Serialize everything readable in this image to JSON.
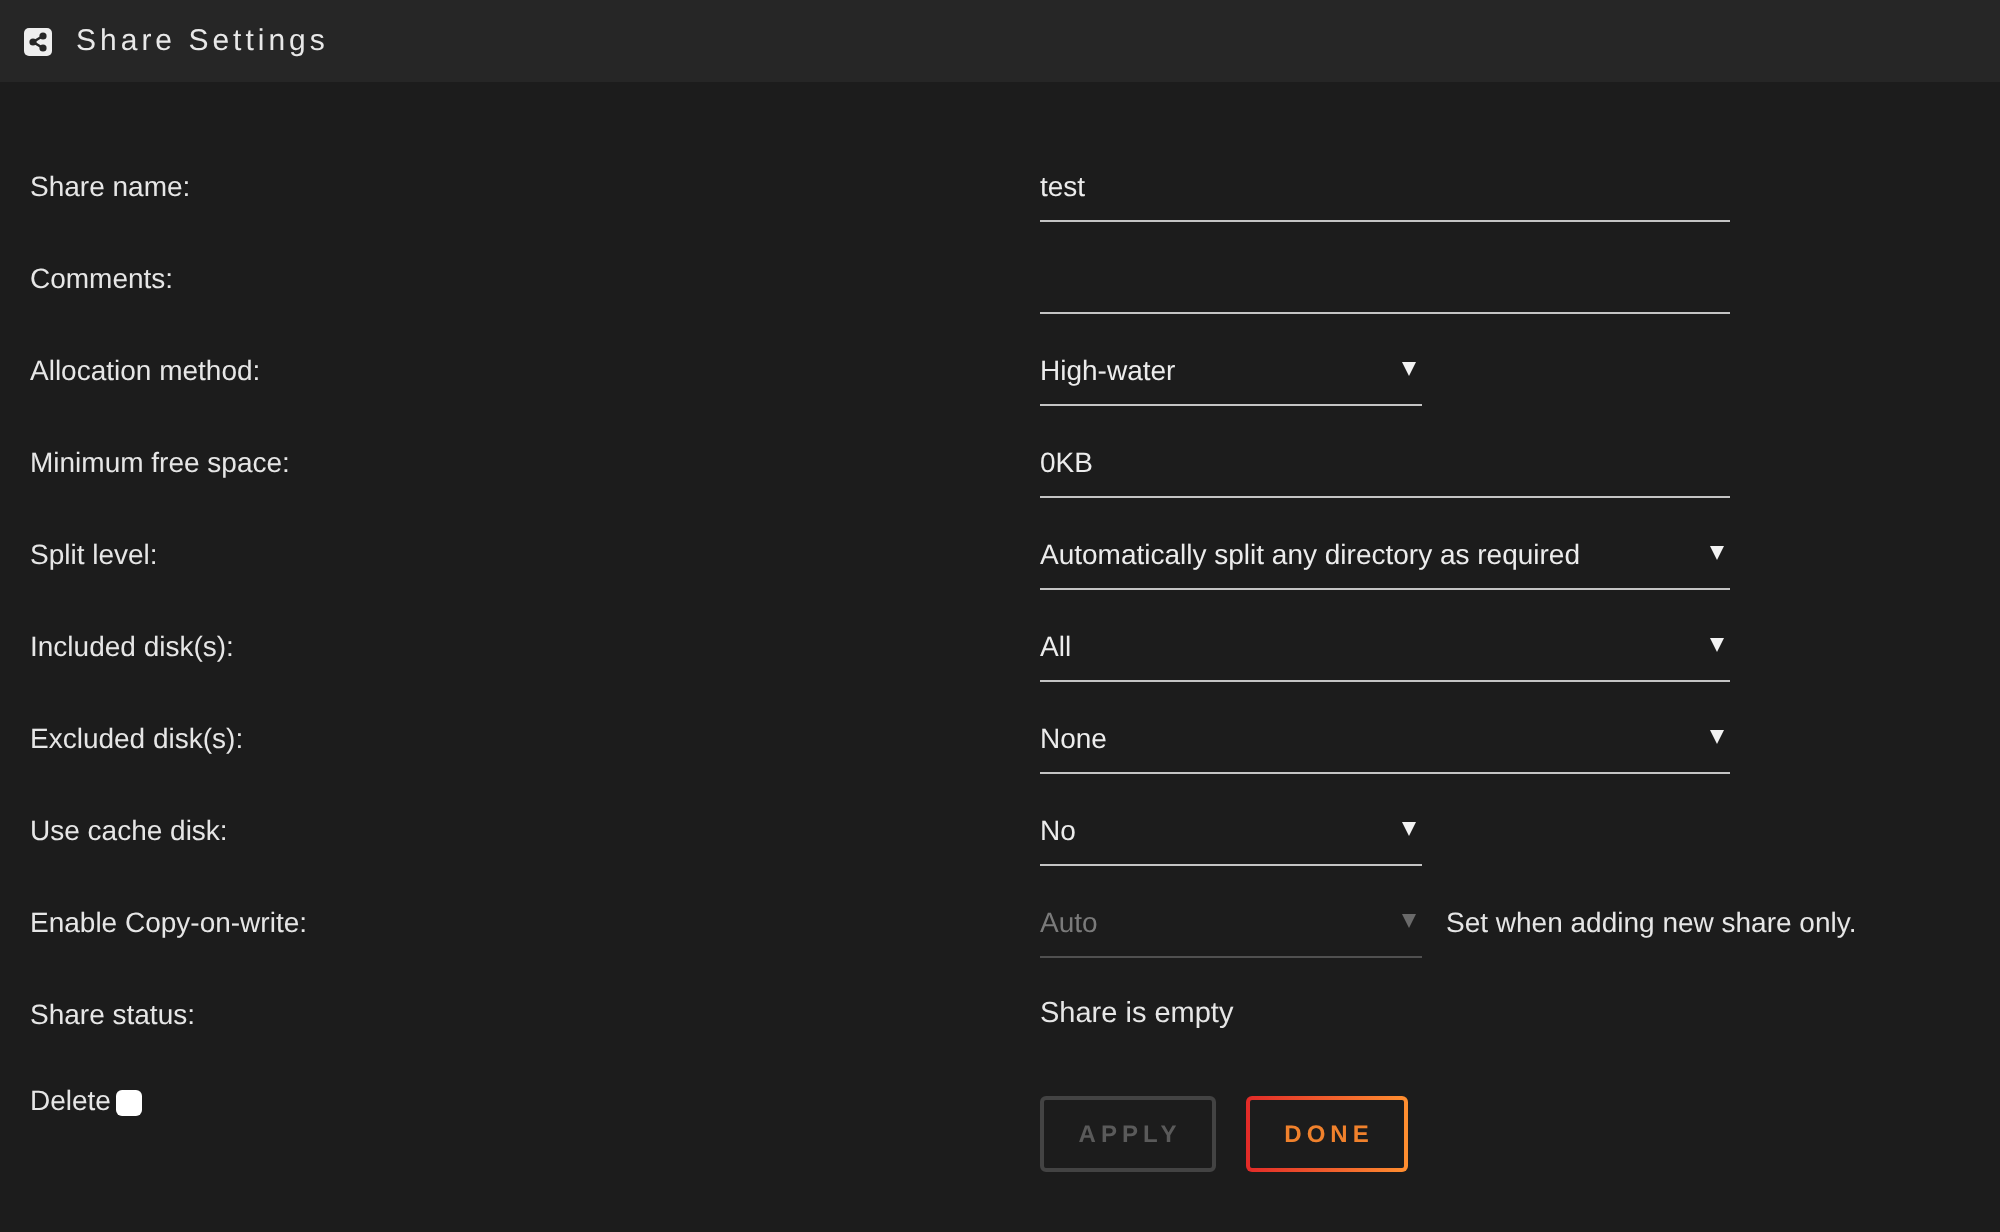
{
  "header": {
    "title": "Share Settings"
  },
  "fields": [
    {
      "label": "Share name:",
      "kind": "input",
      "value": "test",
      "disabled": false
    },
    {
      "label": "Comments:",
      "kind": "input",
      "disabled": false
    },
    {
      "label": "Allocation method:",
      "kind": "shortselect",
      "value": "High-water",
      "disabled": false
    },
    {
      "label": "Minimum free space:",
      "kind": "input",
      "value": "0KB",
      "disabled": false
    },
    {
      "label": "Split level:",
      "kind": "select",
      "value": "Automatically split any directory as required",
      "disabled": false
    },
    {
      "label": "Included disk(s):",
      "kind": "select",
      "value": "All",
      "disabled": false
    },
    {
      "label": "Excluded disk(s):",
      "kind": "select",
      "value": "None",
      "disabled": false
    },
    {
      "label": "Use cache disk:",
      "kind": "shortselect",
      "value": "No",
      "disabled": false
    },
    {
      "label": "Enable Copy-on-write:",
      "kind": "shortselect",
      "value": "Auto",
      "disabled": true,
      "note": "Set when adding new share only."
    },
    {
      "label": "Share status:",
      "kind": "text",
      "value": "Share is empty"
    }
  ],
  "delete": {
    "label": "Delete",
    "checked": false
  },
  "buttons": [
    {
      "label": "APPLY",
      "disabled": true
    },
    {
      "label": "DONE",
      "disabled": false
    }
  ]
}
